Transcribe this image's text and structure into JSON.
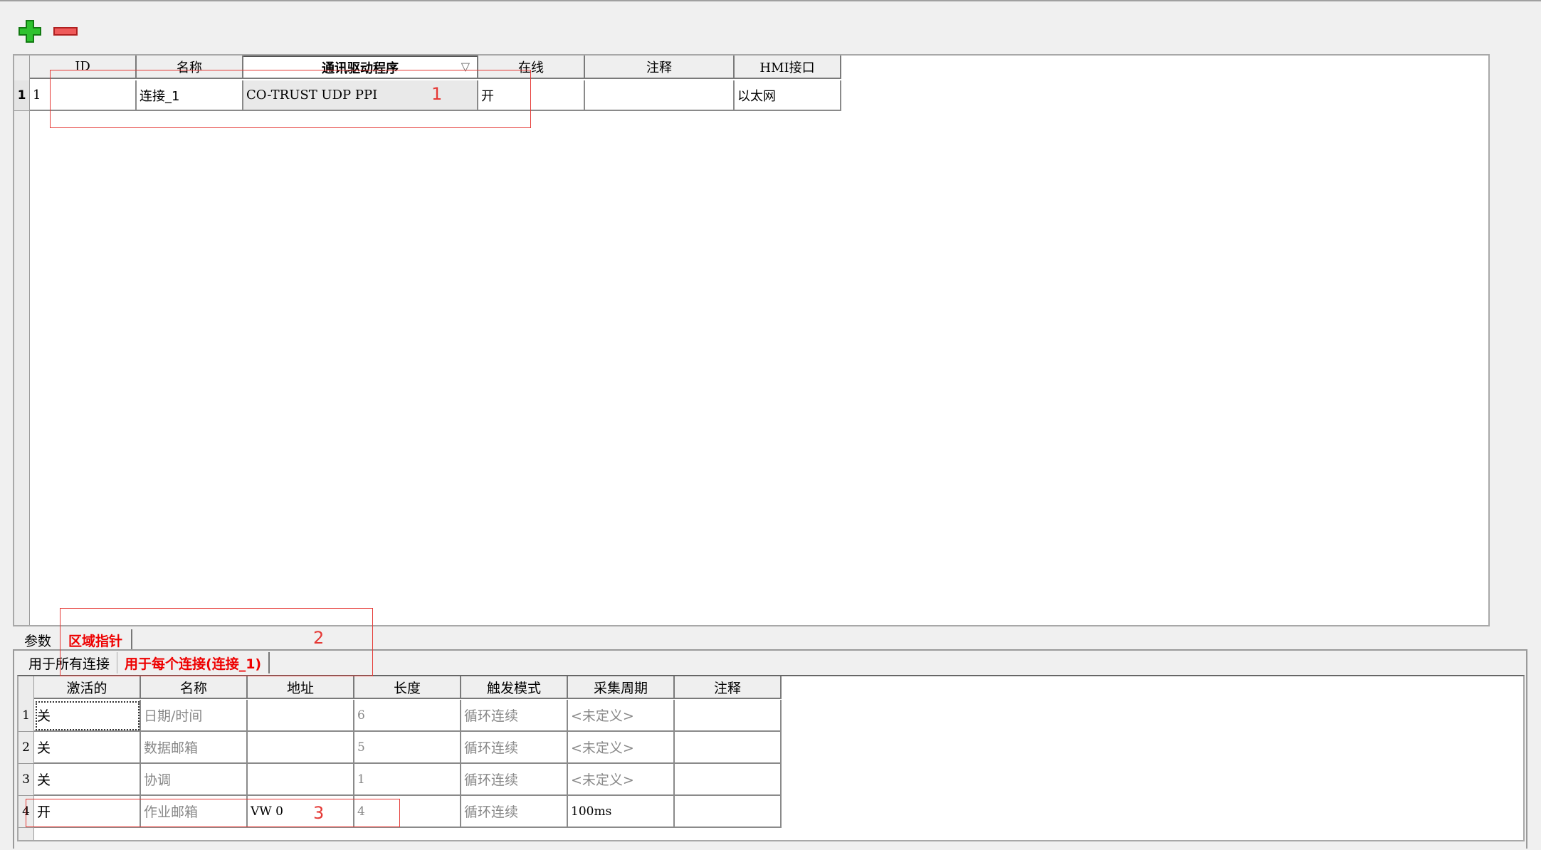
{
  "toolbar": {
    "add_icon": "plus-icon",
    "remove_icon": "minus-icon"
  },
  "connections_table": {
    "headers": [
      "ID",
      "名称",
      "通讯驱动程序",
      "在线",
      "注释",
      "HMI接口"
    ],
    "rows": [
      {
        "row_number": "1",
        "id": "1",
        "name": "连接_1",
        "driver": "CO-TRUST UDP PPI",
        "online": "开",
        "comment": "",
        "hmi_interface": "以太网"
      }
    ]
  },
  "annotations": {
    "box1": "1",
    "box2": "2",
    "box3": "3"
  },
  "main_tabs": {
    "params": "参数",
    "area_pointer": "区域指针"
  },
  "sub_tabs": {
    "all_connections": "用于所有连接",
    "each_connection": "用于每个连接(连接_1)"
  },
  "area_pointer_table": {
    "headers": [
      "激活的",
      "名称",
      "地址",
      "长度",
      "触发模式",
      "采集周期",
      "注释"
    ],
    "rows": [
      {
        "row_number": "1",
        "active": "关",
        "name": "日期/时间",
        "address": "",
        "length": "6",
        "trigger": "循环连续",
        "cycle": "<未定义>",
        "comment": ""
      },
      {
        "row_number": "2",
        "active": "关",
        "name": "数据邮箱",
        "address": "",
        "length": "5",
        "trigger": "循环连续",
        "cycle": "<未定义>",
        "comment": ""
      },
      {
        "row_number": "3",
        "active": "关",
        "name": "协调",
        "address": "",
        "length": "1",
        "trigger": "循环连续",
        "cycle": "<未定义>",
        "comment": ""
      },
      {
        "row_number": "4",
        "active": "开",
        "name": "作业邮箱",
        "address": "VW 0",
        "length": "4",
        "trigger": "循环连续",
        "cycle": "100ms",
        "comment": ""
      }
    ]
  },
  "colors": {
    "accent_red": "#e53935",
    "add_green": "#22b422",
    "remove_red": "#e04040"
  }
}
